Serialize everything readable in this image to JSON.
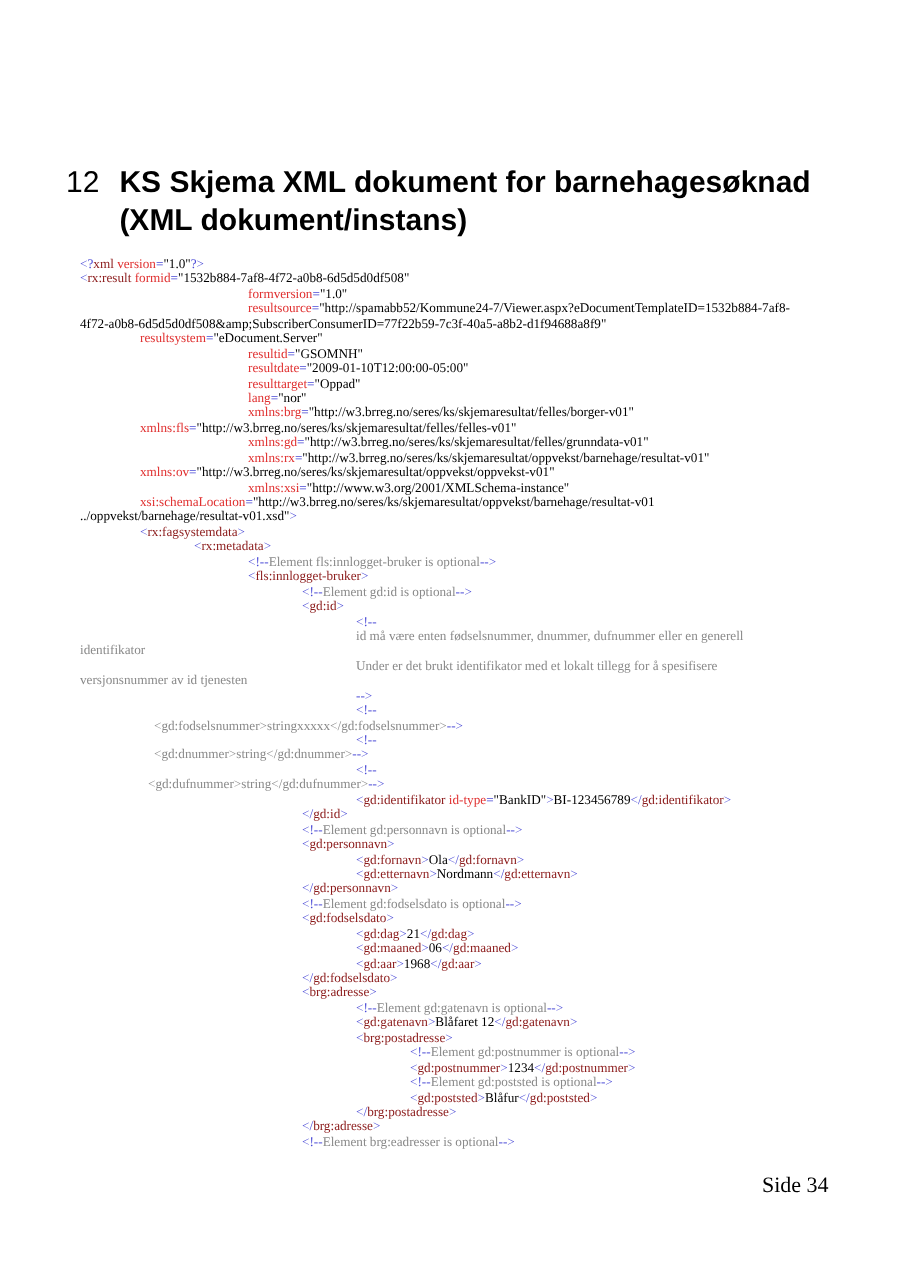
{
  "heading": {
    "number": "12",
    "title": "KS Skjema XML dokument for barnehagesøknad (XML dokument/instans)"
  },
  "code_lines": [
    {
      "segments": [
        {
          "kind": "mark",
          "text": "<?"
        },
        {
          "kind": "tag",
          "text": "xml "
        },
        {
          "kind": "attr",
          "text": "version"
        },
        {
          "kind": "mark",
          "text": "="
        },
        {
          "kind": "value",
          "text": "\"1.0\""
        },
        {
          "kind": "mark",
          "text": "?>"
        }
      ]
    },
    {
      "segments": [
        {
          "kind": "mark",
          "text": "<"
        },
        {
          "kind": "tag",
          "text": "rx:result "
        },
        {
          "kind": "attr",
          "text": "formid"
        },
        {
          "kind": "mark",
          "text": "="
        },
        {
          "kind": "value",
          "text": "\"1532b884-7af8-4f72-a0b8-6d5d5d0df508\""
        }
      ]
    },
    {
      "segments": [
        {
          "kind": "attr",
          "text": "formversion"
        },
        {
          "kind": "mark",
          "text": "="
        },
        {
          "kind": "value",
          "text": "\"1.0\""
        }
      ]
    },
    {
      "segments": [
        {
          "kind": "attr",
          "text": "resultsource"
        },
        {
          "kind": "mark",
          "text": "="
        },
        {
          "kind": "value",
          "text": "\"http://spamabb52/Kommune24-7/Viewer.aspx?eDocumentTemplateID=1532b884-7af8-"
        }
      ]
    },
    {
      "segments": [
        {
          "kind": "value",
          "text": "4f72-a0b8-6d5d5d0df508&amp;SubscriberConsumerID=77f22b59-7c3f-40a5-a8b2-d1f94688a8f9\""
        }
      ]
    },
    {
      "segments": [
        {
          "kind": "attr",
          "text": "resultsystem"
        },
        {
          "kind": "mark",
          "text": "="
        },
        {
          "kind": "value",
          "text": "\"eDocument.Server\""
        }
      ]
    },
    {
      "segments": [
        {
          "kind": "attr",
          "text": "resultid"
        },
        {
          "kind": "mark",
          "text": "="
        },
        {
          "kind": "value",
          "text": "\"GSOMNH\""
        }
      ]
    },
    {
      "segments": [
        {
          "kind": "attr",
          "text": "resultdate"
        },
        {
          "kind": "mark",
          "text": "="
        },
        {
          "kind": "value",
          "text": "\"2009-01-10T12:00:00-05:00\""
        }
      ]
    },
    {
      "segments": [
        {
          "kind": "attr",
          "text": "resulttarget"
        },
        {
          "kind": "mark",
          "text": "="
        },
        {
          "kind": "value",
          "text": "\"Oppad\""
        }
      ]
    },
    {
      "segments": [
        {
          "kind": "attr",
          "text": "lang"
        },
        {
          "kind": "mark",
          "text": "="
        },
        {
          "kind": "value",
          "text": "\"nor\""
        }
      ]
    },
    {
      "segments": [
        {
          "kind": "attr",
          "text": "xmlns:brg"
        },
        {
          "kind": "mark",
          "text": "="
        },
        {
          "kind": "value",
          "text": "\"http://w3.brreg.no/seres/ks/skjemaresultat/felles/borger-v01\""
        }
      ]
    },
    {
      "segments": [
        {
          "kind": "attr",
          "text": "xmlns:fls"
        },
        {
          "kind": "mark",
          "text": "="
        },
        {
          "kind": "value",
          "text": "\"http://w3.brreg.no/seres/ks/skjemaresultat/felles/felles-v01\""
        }
      ]
    },
    {
      "segments": [
        {
          "kind": "attr",
          "text": "xmlns:gd"
        },
        {
          "kind": "mark",
          "text": "="
        },
        {
          "kind": "value",
          "text": "\"http://w3.brreg.no/seres/ks/skjemaresultat/felles/grunndata-v01\""
        }
      ]
    },
    {
      "segments": [
        {
          "kind": "attr",
          "text": "xmlns:rx"
        },
        {
          "kind": "mark",
          "text": "="
        },
        {
          "kind": "value",
          "text": "\"http://w3.brreg.no/seres/ks/skjemaresultat/oppvekst/barnehage/resultat-v01\""
        }
      ]
    },
    {
      "segments": [
        {
          "kind": "attr",
          "text": "xmlns:ov"
        },
        {
          "kind": "mark",
          "text": "="
        },
        {
          "kind": "value",
          "text": "\"http://w3.brreg.no/seres/ks/skjemaresultat/oppvekst/oppvekst-v01\""
        }
      ]
    },
    {
      "segments": [
        {
          "kind": "attr",
          "text": "xmlns:xsi"
        },
        {
          "kind": "mark",
          "text": "="
        },
        {
          "kind": "value",
          "text": "\"http://www.w3.org/2001/XMLSchema-instance\""
        }
      ]
    },
    {
      "segments": [
        {
          "kind": "attr",
          "text": "xsi:schemaLocation"
        },
        {
          "kind": "mark",
          "text": "="
        },
        {
          "kind": "value",
          "text": "\"http://w3.brreg.no/seres/ks/skjemaresultat/oppvekst/barnehage/resultat-v01"
        }
      ]
    },
    {
      "segments": [
        {
          "kind": "value",
          "text": "../oppvekst/barnehage/resultat-v01.xsd\""
        },
        {
          "kind": "mark",
          "text": ">"
        }
      ]
    },
    {
      "segments": [
        {
          "kind": "mark",
          "text": "<"
        },
        {
          "kind": "tag",
          "text": "rx:fagsystemdata"
        },
        {
          "kind": "mark",
          "text": ">"
        }
      ]
    },
    {
      "segments": [
        {
          "kind": "mark",
          "text": "<"
        },
        {
          "kind": "tag",
          "text": "rx:metadata"
        },
        {
          "kind": "mark",
          "text": ">"
        }
      ]
    },
    {
      "segments": [
        {
          "kind": "mark",
          "text": "<!--"
        },
        {
          "kind": "comment",
          "text": "Element fls:innlogget-bruker is optional"
        },
        {
          "kind": "mark",
          "text": "-->"
        }
      ]
    },
    {
      "segments": [
        {
          "kind": "mark",
          "text": "<"
        },
        {
          "kind": "tag",
          "text": "fls:innlogget-bruker"
        },
        {
          "kind": "mark",
          "text": ">"
        }
      ]
    },
    {
      "segments": [
        {
          "kind": "mark",
          "text": "<!--"
        },
        {
          "kind": "comment",
          "text": "Element gd:id is optional"
        },
        {
          "kind": "mark",
          "text": "-->"
        }
      ]
    },
    {
      "segments": [
        {
          "kind": "mark",
          "text": "<"
        },
        {
          "kind": "tag",
          "text": "gd:id"
        },
        {
          "kind": "mark",
          "text": ">"
        }
      ]
    },
    {
      "segments": [
        {
          "kind": "mark",
          "text": "<!--"
        }
      ]
    },
    {
      "segments": [
        {
          "kind": "comment",
          "text": "id må være enten fødselsnummer, dnummer, dufnummer eller en generell"
        }
      ]
    },
    {
      "segments": [
        {
          "kind": "comment",
          "text": "identifikator"
        }
      ]
    },
    {
      "segments": [
        {
          "kind": "comment",
          "text": "Under er det brukt identifikator med et lokalt tillegg for å spesifisere"
        }
      ]
    },
    {
      "segments": [
        {
          "kind": "comment",
          "text": "versjonsnummer av id tjenesten"
        }
      ]
    },
    {
      "segments": [
        {
          "kind": "mark",
          "text": "-->"
        }
      ]
    },
    {
      "segments": [
        {
          "kind": "mark",
          "text": "<!--"
        }
      ]
    },
    {
      "segments": [
        {
          "kind": "comment",
          "text": "<gd:fodselsnummer>stringxxxxx</gd:fodselsnummer>"
        },
        {
          "kind": "mark",
          "text": "-->"
        }
      ]
    },
    {
      "segments": [
        {
          "kind": "mark",
          "text": "<!--"
        }
      ]
    },
    {
      "segments": [
        {
          "kind": "comment",
          "text": "<gd:dnummer>string</gd:dnummer>"
        },
        {
          "kind": "mark",
          "text": "-->"
        }
      ]
    },
    {
      "segments": [
        {
          "kind": "mark",
          "text": "<!--"
        }
      ]
    },
    {
      "segments": [
        {
          "kind": "comment",
          "text": "<gd:dufnummer>string</gd:dufnummer>"
        },
        {
          "kind": "mark",
          "text": "-->"
        }
      ]
    },
    {
      "segments": [
        {
          "kind": "mark",
          "text": "<"
        },
        {
          "kind": "tag",
          "text": "gd:identifikator "
        },
        {
          "kind": "attr",
          "text": "id-type"
        },
        {
          "kind": "mark",
          "text": "="
        },
        {
          "kind": "value",
          "text": "\"BankID\""
        },
        {
          "kind": "mark",
          "text": ">"
        },
        {
          "kind": "value",
          "text": "BI-123456789"
        },
        {
          "kind": "mark",
          "text": "</"
        },
        {
          "kind": "tag",
          "text": "gd:identifikator"
        },
        {
          "kind": "mark",
          "text": ">"
        }
      ]
    },
    {
      "segments": [
        {
          "kind": "mark",
          "text": "</"
        },
        {
          "kind": "tag",
          "text": "gd:id"
        },
        {
          "kind": "mark",
          "text": ">"
        }
      ]
    },
    {
      "segments": [
        {
          "kind": "mark",
          "text": "<!--"
        },
        {
          "kind": "comment",
          "text": "Element gd:personnavn is optional"
        },
        {
          "kind": "mark",
          "text": "-->"
        }
      ]
    },
    {
      "segments": [
        {
          "kind": "mark",
          "text": "<"
        },
        {
          "kind": "tag",
          "text": "gd:personnavn"
        },
        {
          "kind": "mark",
          "text": ">"
        }
      ]
    },
    {
      "segments": [
        {
          "kind": "mark",
          "text": "<"
        },
        {
          "kind": "tag",
          "text": "gd:fornavn"
        },
        {
          "kind": "mark",
          "text": ">"
        },
        {
          "kind": "value",
          "text": "Ola"
        },
        {
          "kind": "mark",
          "text": "</"
        },
        {
          "kind": "tag",
          "text": "gd:fornavn"
        },
        {
          "kind": "mark",
          "text": ">"
        }
      ]
    },
    {
      "segments": [
        {
          "kind": "mark",
          "text": "<"
        },
        {
          "kind": "tag",
          "text": "gd:etternavn"
        },
        {
          "kind": "mark",
          "text": ">"
        },
        {
          "kind": "value",
          "text": "Nordmann"
        },
        {
          "kind": "mark",
          "text": "</"
        },
        {
          "kind": "tag",
          "text": "gd:etternavn"
        },
        {
          "kind": "mark",
          "text": ">"
        }
      ]
    },
    {
      "segments": [
        {
          "kind": "mark",
          "text": "</"
        },
        {
          "kind": "tag",
          "text": "gd:personnavn"
        },
        {
          "kind": "mark",
          "text": ">"
        }
      ]
    },
    {
      "segments": [
        {
          "kind": "mark",
          "text": "<!--"
        },
        {
          "kind": "comment",
          "text": "Element gd:fodselsdato is optional"
        },
        {
          "kind": "mark",
          "text": "-->"
        }
      ]
    },
    {
      "segments": [
        {
          "kind": "mark",
          "text": "<"
        },
        {
          "kind": "tag",
          "text": "gd:fodselsdato"
        },
        {
          "kind": "mark",
          "text": ">"
        }
      ]
    },
    {
      "segments": [
        {
          "kind": "mark",
          "text": "<"
        },
        {
          "kind": "tag",
          "text": "gd:dag"
        },
        {
          "kind": "mark",
          "text": ">"
        },
        {
          "kind": "value",
          "text": "21"
        },
        {
          "kind": "mark",
          "text": "</"
        },
        {
          "kind": "tag",
          "text": "gd:dag"
        },
        {
          "kind": "mark",
          "text": ">"
        }
      ]
    },
    {
      "segments": [
        {
          "kind": "mark",
          "text": "<"
        },
        {
          "kind": "tag",
          "text": "gd:maaned"
        },
        {
          "kind": "mark",
          "text": ">"
        },
        {
          "kind": "value",
          "text": "06"
        },
        {
          "kind": "mark",
          "text": "</"
        },
        {
          "kind": "tag",
          "text": "gd:maaned"
        },
        {
          "kind": "mark",
          "text": ">"
        }
      ]
    },
    {
      "segments": [
        {
          "kind": "mark",
          "text": "<"
        },
        {
          "kind": "tag",
          "text": "gd:aar"
        },
        {
          "kind": "mark",
          "text": ">"
        },
        {
          "kind": "value",
          "text": "1968"
        },
        {
          "kind": "mark",
          "text": "</"
        },
        {
          "kind": "tag",
          "text": "gd:aar"
        },
        {
          "kind": "mark",
          "text": ">"
        }
      ]
    },
    {
      "segments": [
        {
          "kind": "mark",
          "text": "</"
        },
        {
          "kind": "tag",
          "text": "gd:fodselsdato"
        },
        {
          "kind": "mark",
          "text": ">"
        }
      ]
    },
    {
      "segments": [
        {
          "kind": "mark",
          "text": "<"
        },
        {
          "kind": "tag",
          "text": "brg:adresse"
        },
        {
          "kind": "mark",
          "text": ">"
        }
      ]
    },
    {
      "segments": [
        {
          "kind": "mark",
          "text": "<!--"
        },
        {
          "kind": "comment",
          "text": "Element gd:gatenavn is optional"
        },
        {
          "kind": "mark",
          "text": "-->"
        }
      ]
    },
    {
      "segments": [
        {
          "kind": "mark",
          "text": "<"
        },
        {
          "kind": "tag",
          "text": "gd:gatenavn"
        },
        {
          "kind": "mark",
          "text": ">"
        },
        {
          "kind": "value",
          "text": "Blåfaret 12"
        },
        {
          "kind": "mark",
          "text": "</"
        },
        {
          "kind": "tag",
          "text": "gd:gatenavn"
        },
        {
          "kind": "mark",
          "text": ">"
        }
      ]
    },
    {
      "segments": [
        {
          "kind": "mark",
          "text": "<"
        },
        {
          "kind": "tag",
          "text": "brg:postadresse"
        },
        {
          "kind": "mark",
          "text": ">"
        }
      ]
    },
    {
      "segments": [
        {
          "kind": "mark",
          "text": "<!--"
        },
        {
          "kind": "comment",
          "text": "Element gd:postnummer is optional"
        },
        {
          "kind": "mark",
          "text": "-->"
        }
      ]
    },
    {
      "segments": [
        {
          "kind": "mark",
          "text": "<"
        },
        {
          "kind": "tag",
          "text": "gd:postnummer"
        },
        {
          "kind": "mark",
          "text": ">"
        },
        {
          "kind": "value",
          "text": "1234"
        },
        {
          "kind": "mark",
          "text": "</"
        },
        {
          "kind": "tag",
          "text": "gd:postnummer"
        },
        {
          "kind": "mark",
          "text": ">"
        }
      ]
    },
    {
      "segments": [
        {
          "kind": "mark",
          "text": "<!--"
        },
        {
          "kind": "comment",
          "text": "Element gd:poststed is optional"
        },
        {
          "kind": "mark",
          "text": "-->"
        }
      ]
    },
    {
      "segments": [
        {
          "kind": "mark",
          "text": "<"
        },
        {
          "kind": "tag",
          "text": "gd:poststed"
        },
        {
          "kind": "mark",
          "text": ">"
        },
        {
          "kind": "value",
          "text": "Blåfur"
        },
        {
          "kind": "mark",
          "text": "</"
        },
        {
          "kind": "tag",
          "text": "gd:poststed"
        },
        {
          "kind": "mark",
          "text": ">"
        }
      ]
    },
    {
      "segments": [
        {
          "kind": "mark",
          "text": "</"
        },
        {
          "kind": "tag",
          "text": "brg:postadresse"
        },
        {
          "kind": "mark",
          "text": ">"
        }
      ]
    },
    {
      "segments": [
        {
          "kind": "mark",
          "text": "</"
        },
        {
          "kind": "tag",
          "text": "brg:adresse"
        },
        {
          "kind": "mark",
          "text": ">"
        }
      ]
    },
    {
      "segments": [
        {
          "kind": "mark",
          "text": "<!--"
        },
        {
          "kind": "comment",
          "text": "Element brg:eadresser is optional"
        },
        {
          "kind": "mark",
          "text": "-->"
        }
      ]
    }
  ],
  "page_number": "Side 34"
}
